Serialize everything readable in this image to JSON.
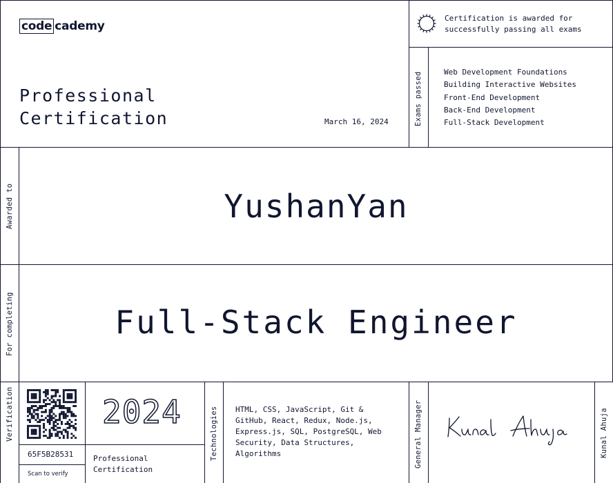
{
  "brand": {
    "logo_box": "code",
    "logo_rest": "cademy"
  },
  "header": {
    "title_line1": "Professional",
    "title_line2": "Certification",
    "date": "March 16, 2024",
    "awarded_note_line1": "Certification is awarded for",
    "awarded_note_line2": "successfully passing all exams"
  },
  "exams": {
    "label": "Exams passed",
    "items": [
      "Web Development Foundations",
      "Building Interactive Websites",
      "Front-End Development",
      "Back-End Development",
      "Full-Stack Development"
    ]
  },
  "recipient": {
    "label": "Awarded to",
    "name": "YushanYan"
  },
  "program": {
    "label": "For completing",
    "title": "Full-Stack Engineer"
  },
  "verification": {
    "label": "Verification",
    "id": "65F5B28531",
    "scan_text": "Scan to verify"
  },
  "year": "2024",
  "bottom_cert": {
    "line1": "Professional",
    "line2": "Certification"
  },
  "technologies": {
    "label": "Technologies",
    "lines": [
      "HTML, CSS, JavaScript, Git &",
      "GitHub, React, Redux, Node.js,",
      "Express.js, SQL, PostgreSQL, Web",
      "Security, Data Structures,",
      "Algorithms"
    ]
  },
  "signer": {
    "role": "General Manager",
    "name": "Kunal Ahuja",
    "signature": "Kunal Ahuja"
  },
  "icons": {
    "seal": "badge-seal-icon",
    "qr": "qr-code-icon"
  },
  "colors": {
    "ink": "#10162f",
    "background": "#ffffff"
  }
}
